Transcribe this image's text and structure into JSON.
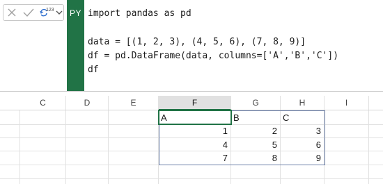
{
  "formula_bar": {
    "badge": "PY",
    "insert_superscript": "123",
    "code_lines": [
      "import pandas as pd",
      "",
      "data = [(1, 2, 3), (4, 5, 6), (7, 8, 9)]",
      "df = pd.DataFrame(data, columns=['A','B','C'])",
      "df"
    ]
  },
  "grid": {
    "columns": [
      "C",
      "D",
      "E",
      "F",
      "G",
      "H",
      "I"
    ],
    "selected_column": "F",
    "table": {
      "headers": [
        "A",
        "B",
        "C"
      ],
      "rows": [
        [
          "1",
          "2",
          "3"
        ],
        [
          "4",
          "5",
          "6"
        ],
        [
          "7",
          "8",
          "9"
        ]
      ]
    }
  },
  "colors": {
    "accent": "#217346",
    "table_border": "#6b7fa8",
    "gridline": "#e1e1e1"
  },
  "icons": {
    "cancel": "close-icon",
    "enter": "check-icon",
    "insert": "insert-data-type-icon",
    "dropdown": "chevron-down-icon"
  }
}
